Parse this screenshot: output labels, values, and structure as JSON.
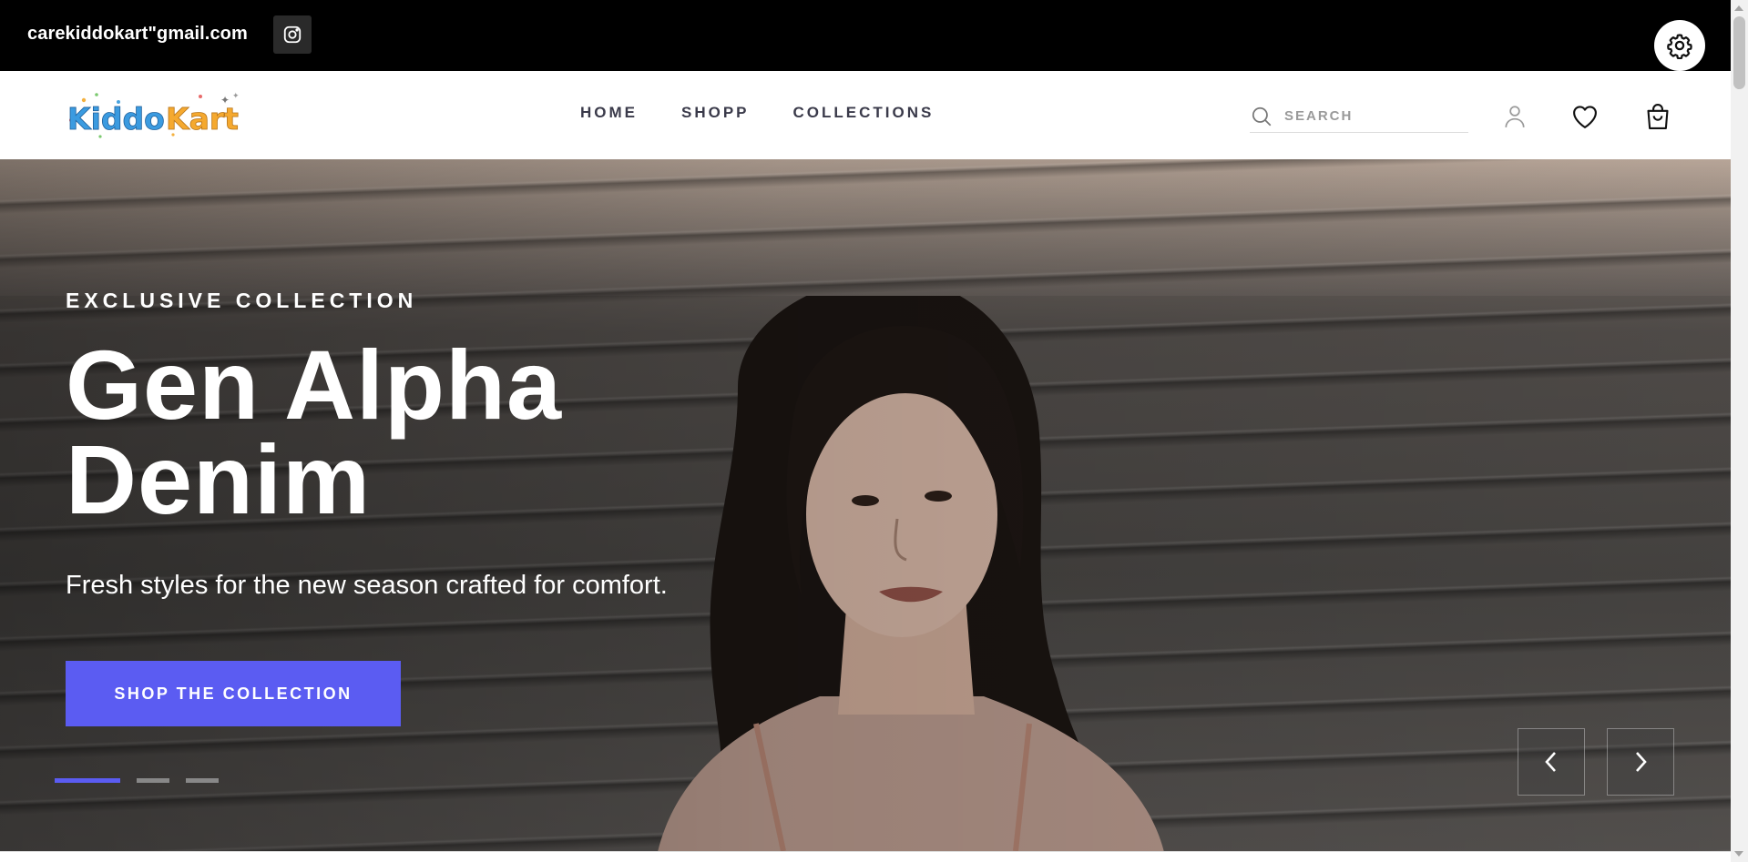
{
  "topbar": {
    "email": "carekiddokart\"gmail.com",
    "instagram_icon": "instagram-icon",
    "settings_icon": "gear-icon",
    "background": "#000000"
  },
  "header": {
    "logo_text": "KiddoKart",
    "logo_parts": {
      "kiddo": "Kiddo",
      "kart": "Kart"
    },
    "nav": [
      {
        "label": "HOME"
      },
      {
        "label": "SHOPP"
      },
      {
        "label": "COLLECTIONS"
      }
    ],
    "search": {
      "placeholder": "SEARCH",
      "value": ""
    },
    "icons": [
      "user-icon",
      "heart-icon",
      "shopping-bag-icon"
    ]
  },
  "hero": {
    "eyebrow": "EXCLUSIVE COLLECTION",
    "headline": "Gen Alpha Denim",
    "subtext": "Fresh styles for the new season crafted for comfort.",
    "cta_label": "SHOP THE COLLECTION",
    "accent_color": "#5b5cf2",
    "slides_total": 3,
    "active_slide": 1,
    "prev_icon": "chevron-left-icon",
    "next_icon": "chevron-right-icon"
  }
}
